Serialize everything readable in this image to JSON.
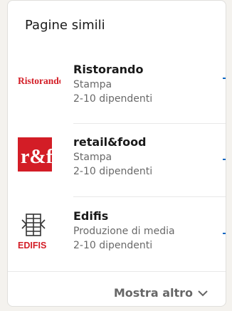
{
  "panel": {
    "title": "Pagine simili",
    "show_more_label": "Mostra altro"
  },
  "items": [
    {
      "name": "Ristorando",
      "industry": "Stampa",
      "size": "2-10 dipendenti",
      "logo_text": "Ristorando"
    },
    {
      "name": "retail&food",
      "industry": "Stampa",
      "size": "2-10 dipendenti",
      "logo_text": "r&f"
    },
    {
      "name": "Edifis",
      "industry": "Produzione di media",
      "size": "2-10 dipendenti",
      "logo_text": "EDIFIS"
    }
  ],
  "colors": {
    "accent": "#0a66c2",
    "logo_red": "#d31d26"
  }
}
